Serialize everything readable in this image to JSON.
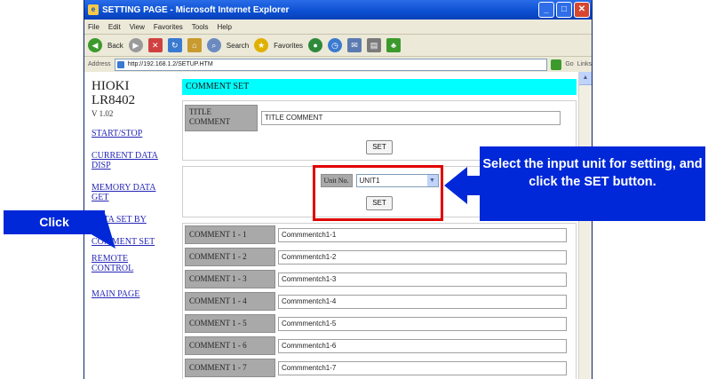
{
  "window": {
    "title": "SETTING PAGE - Microsoft Internet Explorer",
    "menu": [
      "File",
      "Edit",
      "View",
      "Favorites",
      "Tools",
      "Help"
    ],
    "toolbar": {
      "back": "Back",
      "search": "Search",
      "favorites": "Favorites"
    },
    "address_label": "Address",
    "address": "http://192.168.1.2/SETUP.HTM",
    "go": "Go",
    "links": "Links"
  },
  "nav": {
    "brand_line1": "HIOKI",
    "brand_line2": "LR8402",
    "version": "V 1.02",
    "links": [
      "START/STOP",
      "CURRENT DATA DISP",
      "MEMORY DATA GET",
      "DATA SET BY",
      "COMMENT SET",
      "REMOTE CONTROL",
      "MAIN PAGE"
    ]
  },
  "main": {
    "header": "COMMENT SET",
    "title_label": "TITLE COMMENT",
    "title_value": "TITLE COMMENT",
    "set_label": "SET",
    "unit_label": "Unit No.",
    "unit_value": "UNIT1",
    "comments": [
      {
        "label": "COMMENT 1 - 1",
        "value": "Commmentch1-1"
      },
      {
        "label": "COMMENT 1 - 2",
        "value": "Commmentch1-2"
      },
      {
        "label": "COMMENT 1 - 3",
        "value": "Commmentch1-3"
      },
      {
        "label": "COMMENT 1 - 4",
        "value": "Commmentch1-4"
      },
      {
        "label": "COMMENT 1 - 5",
        "value": "Commmentch1-5"
      },
      {
        "label": "COMMENT 1 - 6",
        "value": "Commmentch1-6"
      },
      {
        "label": "COMMENT 1 - 7",
        "value": "Commmentch1-7"
      }
    ]
  },
  "annotations": {
    "click": "Click",
    "callout": "Select the input unit for setting, and click the SET button."
  },
  "colors": {
    "callout_blue": "#0028d8",
    "highlight_red": "#e00000",
    "header_cyan": "#00ffff"
  }
}
